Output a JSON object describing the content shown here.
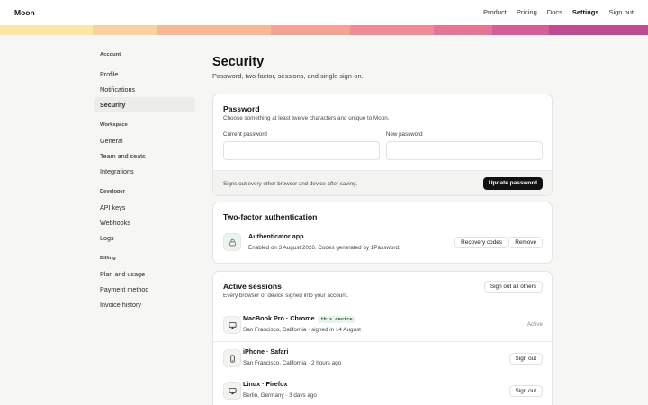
{
  "app": {
    "name": "Moon"
  },
  "topnav": [
    {
      "label": "Product",
      "active": false
    },
    {
      "label": "Pricing",
      "active": false
    },
    {
      "label": "Docs",
      "active": false
    },
    {
      "label": "Settings",
      "active": true
    },
    {
      "label": "Sign out",
      "active": false
    }
  ],
  "band_colors": [
    "#fbe6a8",
    "#fad1a0",
    "#f6b995",
    "#f3a293",
    "#ee8b93",
    "#e47597",
    "#d45f98",
    "#bf4b93"
  ],
  "sidebar": {
    "sections": [
      {
        "title": "Account",
        "items": [
          {
            "label": "Profile",
            "active": false
          },
          {
            "label": "Notifications",
            "active": false
          },
          {
            "label": "Security",
            "active": true
          }
        ]
      },
      {
        "title": "Workspace",
        "items": [
          {
            "label": "General",
            "active": false
          },
          {
            "label": "Team and seats",
            "active": false
          },
          {
            "label": "Integrations",
            "active": false
          }
        ]
      },
      {
        "title": "Developer",
        "items": [
          {
            "label": "API keys",
            "active": false
          },
          {
            "label": "Webhooks",
            "active": false
          },
          {
            "label": "Logs",
            "active": false
          }
        ]
      },
      {
        "title": "Billing",
        "items": [
          {
            "label": "Plan and usage",
            "active": false
          },
          {
            "label": "Payment method",
            "active": false
          },
          {
            "label": "Invoice history",
            "active": false
          }
        ]
      }
    ]
  },
  "page": {
    "title": "Security",
    "subtitle": "Password, two-factor, sessions, and single sign-on."
  },
  "password": {
    "title": "Password",
    "subtitle": "Choose something at least twelve characters and unique to Moon.",
    "current_label": "Current password",
    "current_value": "",
    "new_label": "New password",
    "new_value": "",
    "footer_note": "Signs out every other browser and device after saving.",
    "update_label": "Update password"
  },
  "two_factor": {
    "title": "Two-factor authentication",
    "method_icon": "lock-icon",
    "method_name": "Authenticator app",
    "method_desc": "Enabled on 3 August 2026. Codes generated by 1Password.",
    "recovery_label": "Recovery codes",
    "remove_label": "Remove"
  },
  "sessions": {
    "title": "Active sessions",
    "subtitle": "Every browser or device signed into your account.",
    "sign_out_all_label": "Sign out all others",
    "items": [
      {
        "icon": "monitor-icon",
        "name": "MacBook Pro · Chrome",
        "badge": "this device",
        "meta": "San Francisco, California · signed in 14 August",
        "state": "Active"
      },
      {
        "icon": "phone-icon",
        "name": "iPhone · Safari",
        "meta": "San Francisco, California · 2 hours ago",
        "action": "Sign out"
      },
      {
        "icon": "monitor-icon",
        "name": "Linux · Firefox",
        "meta": "Berlin, Germany · 3 days ago",
        "action": "Sign out"
      }
    ]
  }
}
